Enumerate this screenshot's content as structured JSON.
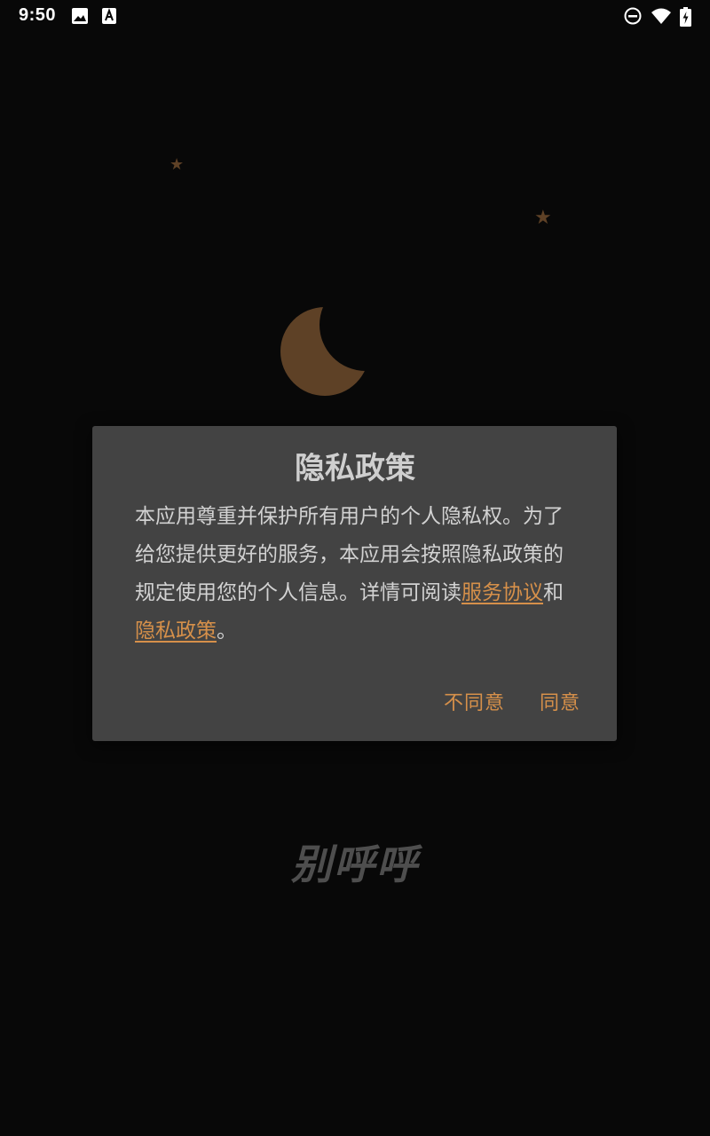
{
  "status_bar": {
    "time": "9:50",
    "left_icons": [
      "image-icon",
      "font-a-icon"
    ],
    "right_icons": [
      "do-not-disturb-icon",
      "wifi-icon",
      "battery-charging-icon"
    ]
  },
  "decor": {
    "icons": [
      "star-icon",
      "star-icon",
      "moon-icon"
    ],
    "accent_color": "#5e4126"
  },
  "dialog": {
    "title": "隐私政策",
    "body_text": "本应用尊重并保护所有用户的个人隐私权。为了给您提供更好的服务，本应用会按照隐私政策的规定使用您的个人信息。详情可阅读",
    "link_service": "服务协议",
    "and_text": "和",
    "link_privacy": "隐私政策",
    "end_text": "。",
    "disagree_label": "不同意",
    "agree_label": "同意",
    "link_color": "#d6904a"
  },
  "app_name": "别呼呼"
}
